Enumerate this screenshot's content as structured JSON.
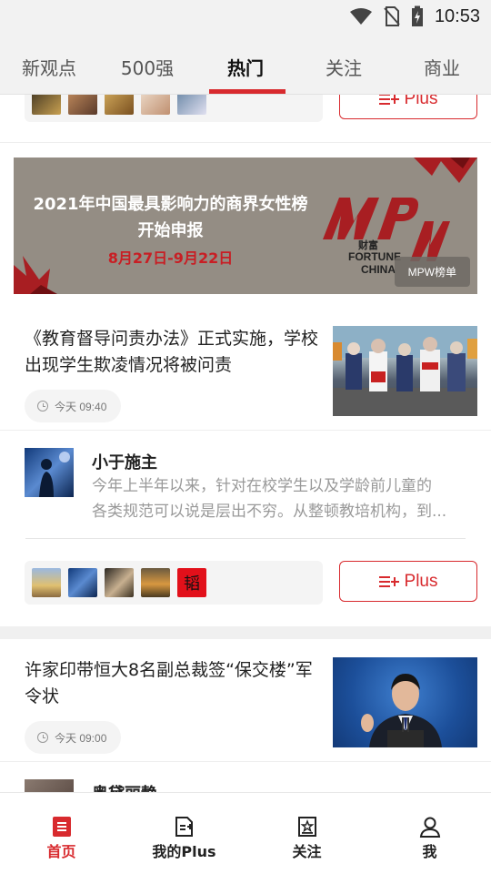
{
  "status_bar": {
    "time": "10:53",
    "icons": [
      "wifi-icon",
      "no-sim-icon",
      "battery-charging-icon"
    ]
  },
  "tabs": [
    {
      "label": "新观点",
      "active": false
    },
    {
      "label": "500强",
      "active": false
    },
    {
      "label": "热门",
      "active": true
    },
    {
      "label": "关注",
      "active": false
    },
    {
      "label": "商业",
      "active": false
    }
  ],
  "partial_card": {
    "plus_label": "Plus"
  },
  "banner": {
    "line1": "2021年中国最具影响力的商界女性榜",
    "line2": "开始申报",
    "date": "8月27日-9月22日",
    "logo_text": "MPW",
    "logo_caption_cn": "财富",
    "logo_caption_en1": "FORTUNE",
    "logo_caption_en2": "CHINA",
    "tag": "MPW榜单"
  },
  "articles": [
    {
      "title": "《教育督导问责办法》正式实施，学校出现学生欺凌情况将被问责",
      "time": "今天 09:40",
      "image": "students-with-backpacks-photo"
    },
    {
      "title": "许家印带恒大8名副总裁签“保交楼”军令状",
      "time": "今天 09:00",
      "image": "speaker-at-podium-photo"
    }
  ],
  "plus_post": {
    "author": "小于施主",
    "excerpt_line1": "今年上半年以来，针对在校学生以及学龄前儿童的",
    "excerpt_line2": "各类规范可以说是层出不穷。从整顿教培机构，到...",
    "plus_label": "Plus",
    "stamp_text": "韬"
  },
  "partial_next": {
    "author": "奥黛丽静"
  },
  "bottom_nav": [
    {
      "label": "首页",
      "icon": "home-doc-icon",
      "active": true
    },
    {
      "label": "我的Plus",
      "icon": "my-plus-icon",
      "active": false
    },
    {
      "label": "关注",
      "icon": "follow-star-icon",
      "active": false
    },
    {
      "label": "我",
      "icon": "person-icon",
      "active": false
    }
  ],
  "colors": {
    "accent": "#d82a2e",
    "banner_bg": "#948d84",
    "chip_bg": "#f4f4f4"
  }
}
